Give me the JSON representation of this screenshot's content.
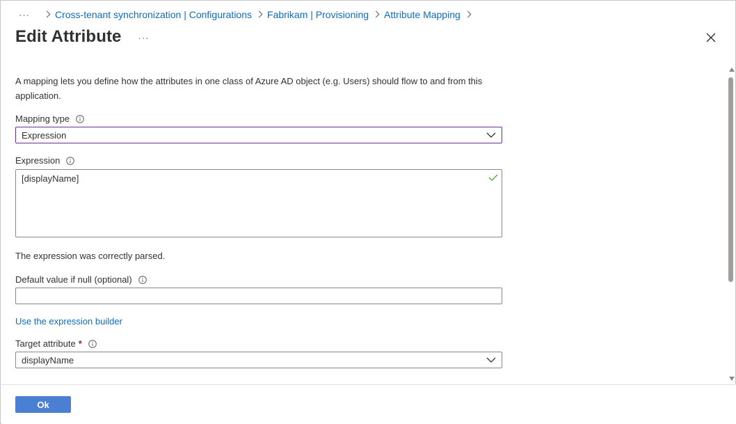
{
  "breadcrumb": {
    "more": "···",
    "items": [
      {
        "label": "Cross-tenant synchronization | Configurations"
      },
      {
        "label": "Fabrikam | Provisioning"
      },
      {
        "label": "Attribute Mapping"
      }
    ]
  },
  "header": {
    "title": "Edit Attribute",
    "more": "···"
  },
  "description": "A mapping lets you define how the attributes in one class of Azure AD object (e.g. Users) should flow to and from this application.",
  "mapping_type": {
    "label": "Mapping type",
    "value": "Expression"
  },
  "expression": {
    "label": "Expression",
    "value": "[displayName]",
    "status": "The expression was correctly parsed."
  },
  "default_value": {
    "label": "Default value if null (optional)",
    "value": ""
  },
  "expression_builder_link": "Use the expression builder",
  "target_attribute": {
    "label": "Target attribute",
    "required_marker": "*",
    "value": "displayName"
  },
  "footer": {
    "ok_label": "Ok"
  },
  "colors": {
    "link": "#0f6cbd",
    "primary_button": "#4a7fd4",
    "focused_border": "#6b2d8e",
    "success_check": "#5aa02c",
    "required": "#a4262c"
  }
}
